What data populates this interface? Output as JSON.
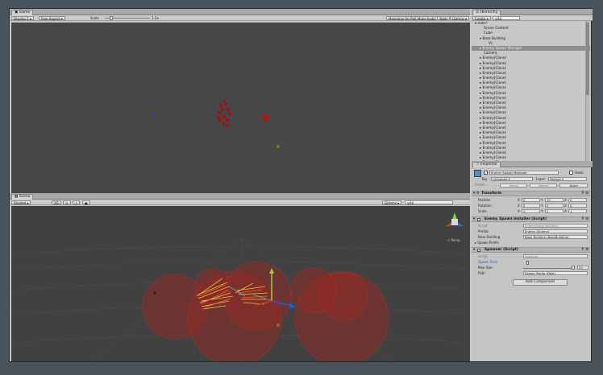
{
  "game": {
    "tab": "Game",
    "display": "Display 1",
    "aspect": "Free Aspect",
    "scale_label": "Scale",
    "scale_value": "1.2x",
    "buttons": [
      "Maximize On Play",
      "Mute Audio",
      "Stats",
      "Gizmos"
    ]
  },
  "scene": {
    "tab": "Scene",
    "shading": "Shaded",
    "mode": "2D",
    "gizmos": "Gizmos",
    "search": "All",
    "persp_label": "< Persp"
  },
  "hierarchy": {
    "tab": "Hierarchy",
    "create": "Create",
    "search": "All",
    "items": [
      {
        "label": "main*",
        "indent": 0,
        "arrow": "down",
        "icon": "unity-scene-icon",
        "selected": false
      },
      {
        "label": "Scene Content",
        "indent": 1,
        "arrow": "",
        "selected": false
      },
      {
        "label": "Cube",
        "indent": 1,
        "arrow": "",
        "selected": false
      },
      {
        "label": "Base Building",
        "indent": 1,
        "arrow": "down",
        "selected": false
      },
      {
        "label": "Vc",
        "indent": 2,
        "arrow": "",
        "selected": false
      },
      {
        "label": "Enemy Spawn Manager",
        "indent": 1,
        "arrow": "right",
        "selected": true
      },
      {
        "label": "Camera",
        "indent": 1,
        "arrow": "",
        "selected": false
      },
      {
        "label": "Enemy(Clone)",
        "indent": 1,
        "arrow": "right",
        "selected": false
      },
      {
        "label": "Enemy(Clone)",
        "indent": 1,
        "arrow": "right",
        "selected": false
      },
      {
        "label": "Enemy(Clone)",
        "indent": 1,
        "arrow": "right",
        "selected": false
      },
      {
        "label": "Enemy(Clone)",
        "indent": 1,
        "arrow": "right",
        "selected": false
      },
      {
        "label": "Enemy(Clone)",
        "indent": 1,
        "arrow": "right",
        "selected": false
      },
      {
        "label": "Enemy(Clone)",
        "indent": 1,
        "arrow": "right",
        "selected": false
      },
      {
        "label": "Enemy(Clone)",
        "indent": 1,
        "arrow": "right",
        "selected": false
      },
      {
        "label": "Enemy(Clone)",
        "indent": 1,
        "arrow": "right",
        "selected": false
      },
      {
        "label": "Enemy(Clone)",
        "indent": 1,
        "arrow": "right",
        "selected": false
      },
      {
        "label": "Enemy(Clone)",
        "indent": 1,
        "arrow": "right",
        "selected": false
      },
      {
        "label": "Enemy(Clone)",
        "indent": 1,
        "arrow": "right",
        "selected": false
      },
      {
        "label": "Enemy(Clone)",
        "indent": 1,
        "arrow": "right",
        "selected": false
      },
      {
        "label": "Enemy(Clone)",
        "indent": 1,
        "arrow": "right",
        "selected": false
      },
      {
        "label": "Enemy(Clone)",
        "indent": 1,
        "arrow": "right",
        "selected": false
      },
      {
        "label": "Enemy(Clone)",
        "indent": 1,
        "arrow": "right",
        "selected": false
      },
      {
        "label": "Enemy(Clone)",
        "indent": 1,
        "arrow": "right",
        "selected": false
      },
      {
        "label": "Enemy(Clone)",
        "indent": 1,
        "arrow": "right",
        "selected": false
      },
      {
        "label": "Enemy(Clone)",
        "indent": 1,
        "arrow": "right",
        "selected": false
      },
      {
        "label": "Enemy(Clone)",
        "indent": 1,
        "arrow": "right",
        "selected": false
      },
      {
        "label": "Enemy(Clone)",
        "indent": 1,
        "arrow": "right",
        "selected": false
      },
      {
        "label": "Enemy(Clone)",
        "indent": 1,
        "arrow": "right",
        "selected": false
      },
      {
        "label": "Enemy(Clone)",
        "indent": 1,
        "arrow": "right",
        "selected": false
      }
    ]
  },
  "inspector": {
    "tab": "Inspector",
    "object_name": "Enemy Spawn Manager",
    "static_label": "Static",
    "tag_label": "Tag",
    "tag_value": "Untagged",
    "layer_label": "Layer",
    "layer_value": "Default",
    "prefab_label": "Prefab",
    "prefab_buttons": [
      "Select",
      "Revert",
      "Apply"
    ],
    "transform": {
      "title": "Transform",
      "rows": [
        {
          "label": "Position",
          "x": "0",
          "y": "10",
          "z": "0"
        },
        {
          "label": "Rotation",
          "x": "0",
          "y": "0",
          "z": "0"
        },
        {
          "label": "Scale",
          "x": "1",
          "y": "1",
          "z": "1"
        }
      ]
    },
    "installer": {
      "title": "Enemy Spawn Installer (Script)",
      "script_label": "Script",
      "script_value": "EnemySpawnInstaller",
      "prefab_label": "Prefab",
      "prefab_value": "Enemy (Enemy)",
      "base_label": "Base Building",
      "base_value": "Base Building (BaseBuilding)",
      "spawners_label": "Spawn Points"
    },
    "spawner": {
      "title": "Spawner (Script)",
      "script_label": "Script",
      "script_value": "Spawner",
      "scale_label": "Spawn Stick",
      "max_label": "Max Size",
      "max_value": "20",
      "path_label": "Path",
      "path_value": "Spawn Points (Path)"
    },
    "add_component": "Add Component"
  },
  "colors": {
    "accent_selected": "#8d8d8d",
    "enemy_red": "#a01010",
    "sphere_red": "#8f2a24"
  }
}
